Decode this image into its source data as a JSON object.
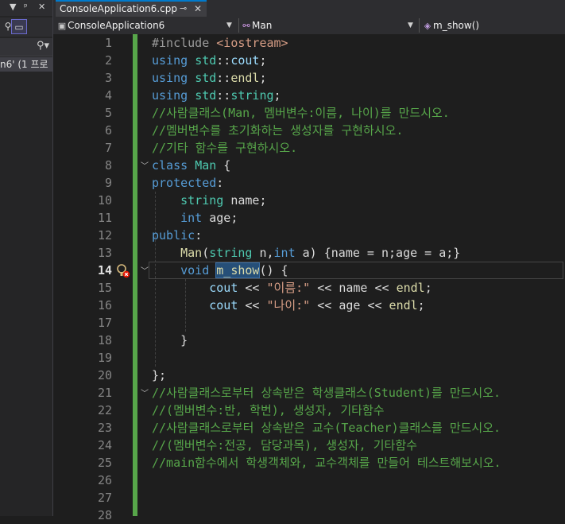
{
  "left_panel": {
    "solution_label": "n6' (1 프로",
    "controls": [
      "▼",
      "ᵖ",
      "✕"
    ]
  },
  "tab": {
    "title": "ConsoleApplication6.cpp",
    "pin_icon": "pin-icon",
    "close_icon": "close-icon"
  },
  "navbar": {
    "project": "ConsoleApplication6",
    "scope": "Man",
    "member": "m_show()"
  },
  "editor": {
    "current_line": 14,
    "line_numbers": [
      "1",
      "2",
      "3",
      "4",
      "5",
      "6",
      "7",
      "8",
      "9",
      "10",
      "11",
      "12",
      "13",
      "14",
      "15",
      "16",
      "17",
      "18",
      "19",
      "20",
      "21",
      "22",
      "23",
      "24",
      "25",
      "26",
      "27",
      "28"
    ],
    "lines": [
      [
        {
          "t": "#include ",
          "c": "pp"
        },
        {
          "t": "<iostream>",
          "c": "str"
        }
      ],
      [
        {
          "t": "using ",
          "c": "kw"
        },
        {
          "t": "std",
          "c": "ty"
        },
        {
          "t": "::",
          "c": "plain"
        },
        {
          "t": "cout",
          "c": "var"
        },
        {
          "t": ";",
          "c": "plain"
        }
      ],
      [
        {
          "t": "using ",
          "c": "kw"
        },
        {
          "t": "std",
          "c": "ty"
        },
        {
          "t": "::",
          "c": "plain"
        },
        {
          "t": "endl",
          "c": "fn"
        },
        {
          "t": ";",
          "c": "plain"
        }
      ],
      [
        {
          "t": "using ",
          "c": "kw"
        },
        {
          "t": "std",
          "c": "ty"
        },
        {
          "t": "::",
          "c": "plain"
        },
        {
          "t": "string",
          "c": "ty"
        },
        {
          "t": ";",
          "c": "plain"
        }
      ],
      [
        {
          "t": "//사람클래스(Man, 멤버변수:이름, 나이)를 만드시오.",
          "c": "cm"
        }
      ],
      [
        {
          "t": "//멤버변수를 초기화하는 생성자를 구현하시오.",
          "c": "cm"
        }
      ],
      [
        {
          "t": "//기타 함수를 구현하시오.",
          "c": "cm"
        }
      ],
      [
        {
          "t": "class ",
          "c": "kw"
        },
        {
          "t": "Man",
          "c": "ty"
        },
        {
          "t": " {",
          "c": "plain"
        }
      ],
      [
        {
          "t": "protected",
          "c": "kw"
        },
        {
          "t": ":",
          "c": "plain"
        }
      ],
      [
        {
          "t": "    ",
          "c": "plain"
        },
        {
          "t": "string",
          "c": "ty"
        },
        {
          "t": " name;",
          "c": "plain"
        }
      ],
      [
        {
          "t": "    ",
          "c": "plain"
        },
        {
          "t": "int",
          "c": "kw"
        },
        {
          "t": " age;",
          "c": "plain"
        }
      ],
      [
        {
          "t": "public",
          "c": "kw"
        },
        {
          "t": ":",
          "c": "plain"
        }
      ],
      [
        {
          "t": "    ",
          "c": "plain"
        },
        {
          "t": "Man",
          "c": "fn"
        },
        {
          "t": "(",
          "c": "plain"
        },
        {
          "t": "string",
          "c": "ty"
        },
        {
          "t": " n,",
          "c": "plain"
        },
        {
          "t": "int",
          "c": "kw"
        },
        {
          "t": " a) {name = n;age = a;}",
          "c": "plain"
        }
      ],
      [
        {
          "t": "    ",
          "c": "plain"
        },
        {
          "t": "void",
          "c": "kw"
        },
        {
          "t": " ",
          "c": "plain"
        },
        {
          "t": "m_show",
          "c": "fn sel"
        },
        {
          "t": "() {",
          "c": "plain"
        }
      ],
      [
        {
          "t": "        ",
          "c": "plain"
        },
        {
          "t": "cout",
          "c": "var"
        },
        {
          "t": " << ",
          "c": "plain"
        },
        {
          "t": "\"이름:\"",
          "c": "str"
        },
        {
          "t": " << name << ",
          "c": "plain"
        },
        {
          "t": "endl",
          "c": "fn"
        },
        {
          "t": ";",
          "c": "plain"
        }
      ],
      [
        {
          "t": "        ",
          "c": "plain"
        },
        {
          "t": "cout",
          "c": "var"
        },
        {
          "t": " << ",
          "c": "plain"
        },
        {
          "t": "\"나이:\"",
          "c": "str"
        },
        {
          "t": " << age << ",
          "c": "plain"
        },
        {
          "t": "endl",
          "c": "fn"
        },
        {
          "t": ";",
          "c": "plain"
        }
      ],
      [
        {
          "t": "",
          "c": "plain"
        }
      ],
      [
        {
          "t": "    }",
          "c": "plain"
        }
      ],
      [
        {
          "t": "",
          "c": "plain"
        }
      ],
      [
        {
          "t": "};",
          "c": "plain"
        }
      ],
      [
        {
          "t": "//사람클래스로부터 상속받은 학생클래스(Student)를 만드시오.",
          "c": "cm"
        }
      ],
      [
        {
          "t": "//(멤버변수:반, 학번), 생성자, 기타함수",
          "c": "cm"
        }
      ],
      [
        {
          "t": "//사람클래스로부터 상속받은 교수(Teacher)클래스를 만드시오.",
          "c": "cm"
        }
      ],
      [
        {
          "t": "//(멤버변수:전공, 담당과목), 생성자, 기타함수",
          "c": "cm"
        }
      ],
      [
        {
          "t": "//main함수에서 학생객체와, 교수객체를 만들어 테스트해보시오.",
          "c": "cm"
        }
      ],
      [
        {
          "t": "",
          "c": "plain"
        }
      ],
      [
        {
          "t": "",
          "c": "plain"
        }
      ],
      [
        {
          "t": "",
          "c": "plain"
        }
      ]
    ],
    "fold_lines": [
      8,
      14,
      21
    ],
    "error_glyph": "quick-action-error-icon"
  },
  "colors": {
    "background": "#1e1e1e",
    "keyword": "#569cd6",
    "type": "#4ec9b0",
    "comment": "#57a64a",
    "string": "#d69d85",
    "function": "#dcdcaa",
    "change_bar": "#57a64a",
    "accent": "#007acc"
  }
}
